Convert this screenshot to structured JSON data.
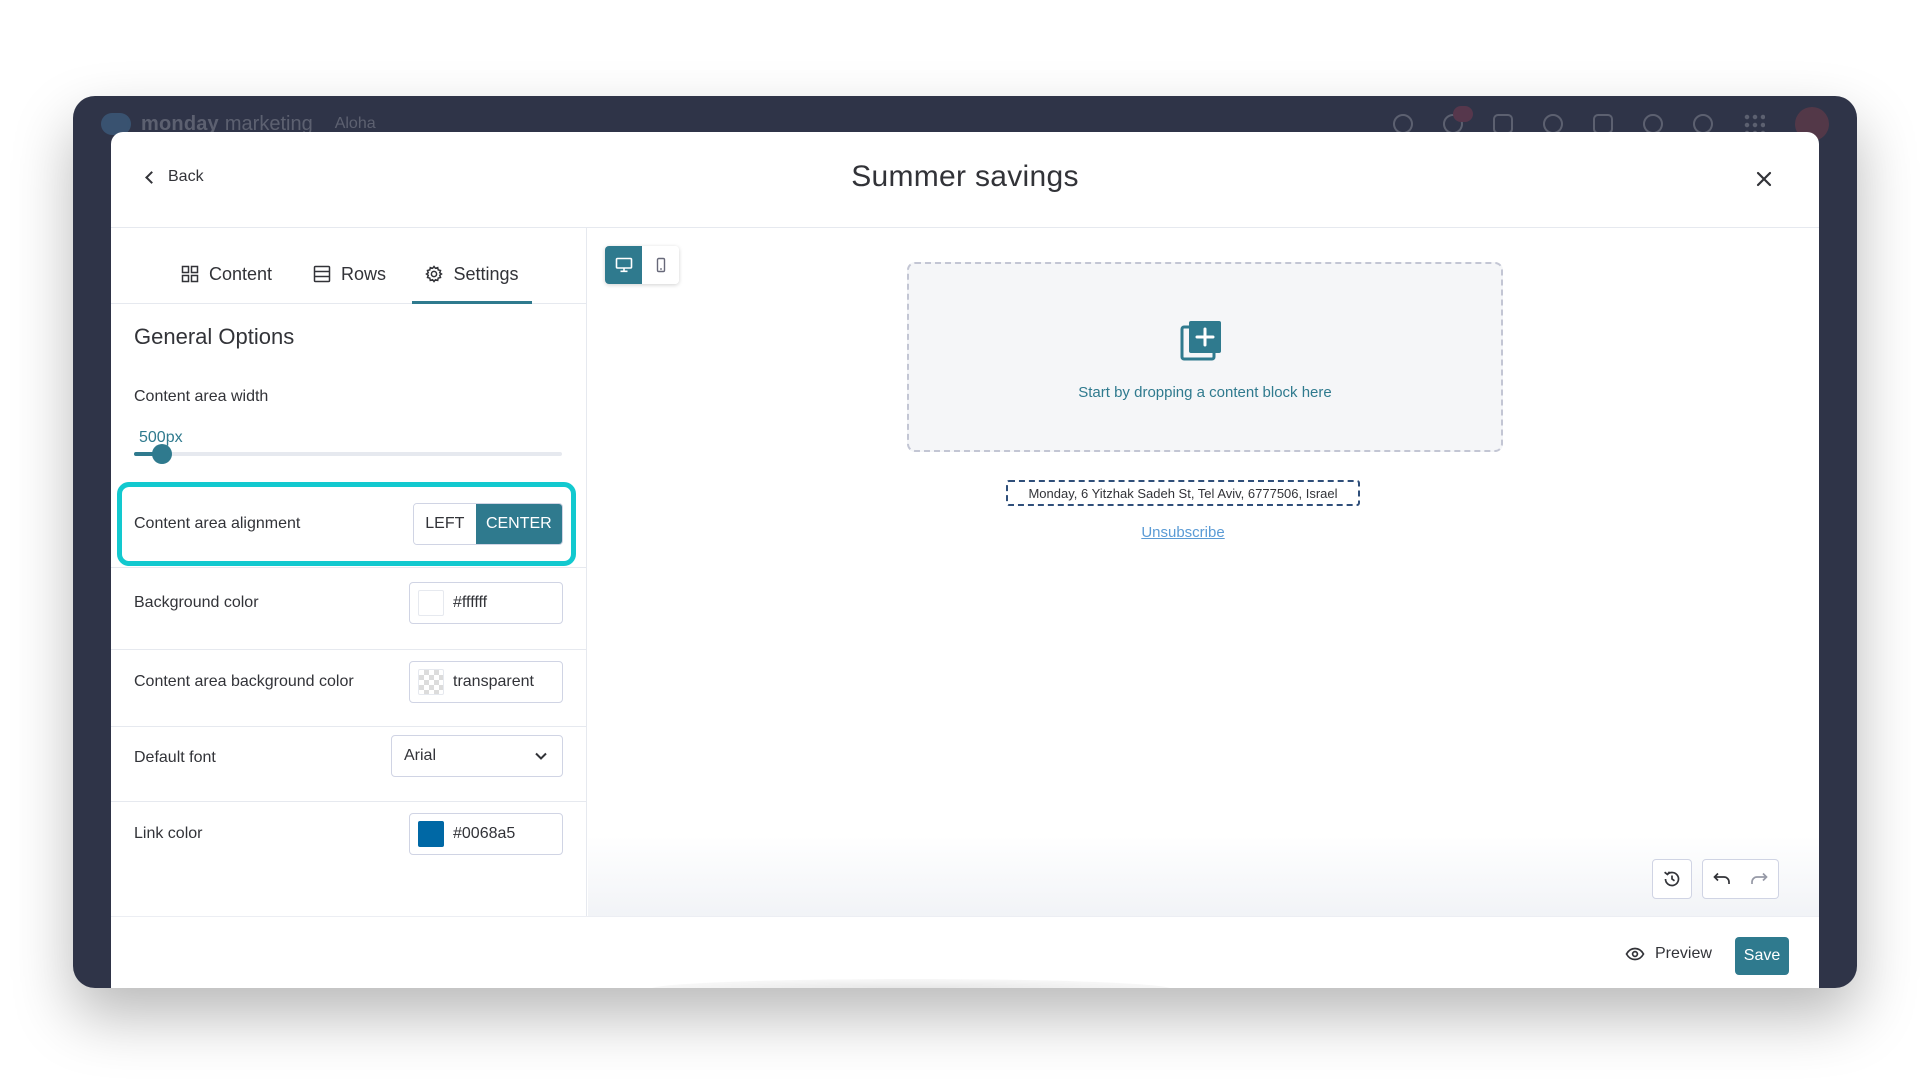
{
  "app": {
    "brand": "monday",
    "brand_suffix": "marketing",
    "workspace": "Aloha"
  },
  "modal": {
    "back_label": "Back",
    "title": "Summer savings"
  },
  "tabs": [
    {
      "label": "Content",
      "icon": "grid-icon"
    },
    {
      "label": "Rows",
      "icon": "rows-icon"
    },
    {
      "label": "Settings",
      "icon": "gear-icon",
      "active": true
    }
  ],
  "settings": {
    "section_title": "General Options",
    "content_area_width": {
      "label": "Content area width",
      "value": "500px",
      "fraction": 0.065
    },
    "alignment": {
      "label": "Content area alignment",
      "left": "LEFT",
      "center": "CENTER",
      "selected": "CENTER"
    },
    "background_color": {
      "label": "Background color",
      "value": "#ffffff"
    },
    "content_area_background": {
      "label": "Content area background color",
      "value": "transparent"
    },
    "default_font": {
      "label": "Default font",
      "value": "Arial"
    },
    "link_color": {
      "label": "Link color",
      "value": "#0068a5"
    }
  },
  "canvas": {
    "drop_text": "Start by dropping a content block here",
    "address": "Monday, 6 Yitzhak Sadeh St, Tel Aviv, 6777506, Israel",
    "unsubscribe": "Unsubscribe"
  },
  "footer": {
    "preview_label": "Preview",
    "save_label": "Save"
  },
  "colors": {
    "accent": "#2f7a8e",
    "highlight": "#12c9cf",
    "link": "#0068a5"
  }
}
